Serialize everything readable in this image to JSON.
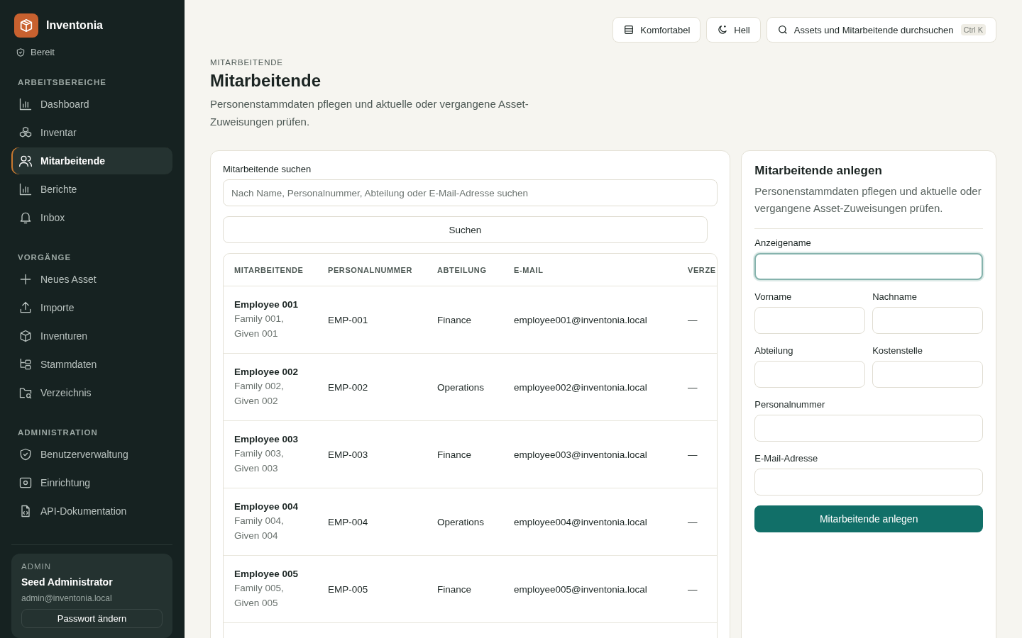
{
  "brand": {
    "name": "Inventonia",
    "status": "Bereit"
  },
  "sidebar": {
    "sections": [
      {
        "title": "ARBEITSBEREICHE",
        "items": [
          {
            "label": "Dashboard",
            "kind": "chart",
            "selected": false
          },
          {
            "label": "Inventar",
            "kind": "boxes",
            "selected": false
          },
          {
            "label": "Mitarbeitende",
            "kind": "users",
            "selected": true
          },
          {
            "label": "Berichte",
            "kind": "chart",
            "selected": false
          },
          {
            "label": "Inbox",
            "kind": "bell",
            "selected": false
          }
        ]
      },
      {
        "title": "VORGÄNGE",
        "items": [
          {
            "label": "Neues Asset",
            "kind": "plus",
            "selected": false
          },
          {
            "label": "Importe",
            "kind": "upload",
            "selected": false
          },
          {
            "label": "Inventuren",
            "kind": "package",
            "selected": false
          },
          {
            "label": "Stammdaten",
            "kind": "tree",
            "selected": false
          },
          {
            "label": "Verzeichnis",
            "kind": "folder",
            "selected": false
          }
        ]
      },
      {
        "title": "ADMINISTRATION",
        "items": [
          {
            "label": "Benutzerverwaltung",
            "kind": "shield",
            "selected": false
          },
          {
            "label": "Einrichtung",
            "kind": "cog",
            "selected": false
          },
          {
            "label": "API-Dokumentation",
            "kind": "code",
            "selected": false
          }
        ]
      }
    ],
    "user": {
      "role": "ADMIN",
      "name": "Seed Administrator",
      "email": "admin@inventonia.local",
      "button": "Passwort ändern"
    }
  },
  "toolbar": {
    "density": "Komfortabel",
    "theme": "Hell",
    "search": "Assets und Mitarbeitende durchsuchen",
    "shortcut": "Ctrl K"
  },
  "page": {
    "eyebrow": "MITARBEITENDE",
    "title": "Mitarbeitende",
    "description": "Personenstammdaten pflegen und aktuelle oder vergangene Asset-Zuweisungen prüfen."
  },
  "search": {
    "label": "Mitarbeitende suchen",
    "placeholder": "Nach Name, Personalnummer, Abteilung oder E-Mail-Adresse suchen",
    "button": "Suchen"
  },
  "table": {
    "columns": [
      "MITARBEITENDE",
      "PERSONALNUMMER",
      "ABTEILUNG",
      "E-MAIL",
      "VERZE"
    ],
    "rows": [
      {
        "name": "Employee 001",
        "detail": "Family 001, Given 001",
        "number": "EMP-001",
        "department": "Finance",
        "email": "employee001@inventonia.local",
        "column_5": "—"
      },
      {
        "name": "Employee 002",
        "detail": "Family 002, Given 002",
        "number": "EMP-002",
        "department": "Operations",
        "email": "employee002@inventonia.local",
        "column_5": "—"
      },
      {
        "name": "Employee 003",
        "detail": "Family 003, Given 003",
        "number": "EMP-003",
        "department": "Finance",
        "email": "employee003@inventonia.local",
        "column_5": "—"
      },
      {
        "name": "Employee 004",
        "detail": "Family 004, Given 004",
        "number": "EMP-004",
        "department": "Operations",
        "email": "employee004@inventonia.local",
        "column_5": "—"
      },
      {
        "name": "Employee 005",
        "detail": "Family 005, Given 005",
        "number": "EMP-005",
        "department": "Finance",
        "email": "employee005@inventonia.local",
        "column_5": "—"
      }
    ]
  },
  "form": {
    "title": "Mitarbeitende anlegen",
    "description": "Personenstammdaten pflegen und aktuelle oder vergangene Asset-Zuweisungen prüfen.",
    "rows": [
      [
        {
          "label": "Anzeigename",
          "focused": true
        }
      ],
      [
        {
          "label": "Vorname",
          "focused": false
        },
        {
          "label": "Nachname",
          "focused": false
        }
      ],
      [
        {
          "label": "Abteilung",
          "focused": false
        },
        {
          "label": "Kostenstelle",
          "focused": false
        }
      ],
      [
        {
          "label": "Personalnummer",
          "focused": false
        }
      ],
      [
        {
          "label": "E-Mail-Adresse",
          "focused": false
        }
      ]
    ],
    "submit": "Mitarbeitende anlegen"
  }
}
